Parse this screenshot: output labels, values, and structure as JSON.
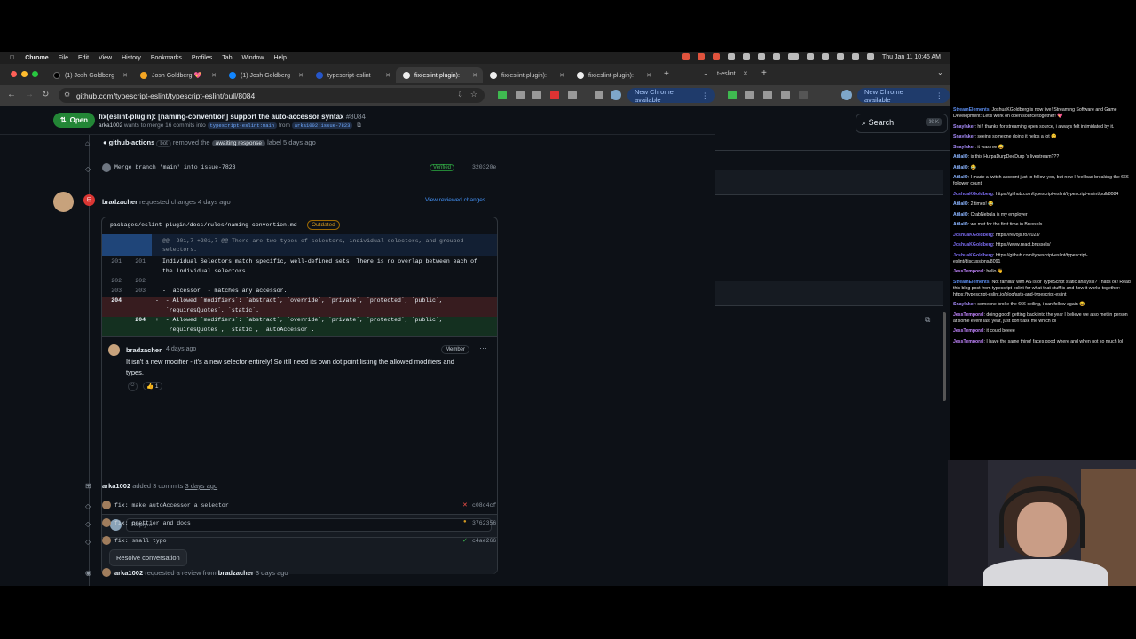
{
  "menubar": {
    "app": "Chrome",
    "items": [
      "File",
      "Edit",
      "View",
      "History",
      "Bookmarks",
      "Profiles",
      "Tab",
      "Window",
      "Help"
    ],
    "clock": "Thu Jan 11  10:45 AM"
  },
  "tabs": [
    {
      "label": "(1) Josh Goldberg"
    },
    {
      "label": "Josh Goldberg 💖"
    },
    {
      "label": "(1) Josh Goldberg"
    },
    {
      "label": "typescript-eslint"
    },
    {
      "label": "fix(eslint-plugin):"
    },
    {
      "label": "fix(eslint-plugin): "
    },
    {
      "label": "fix(eslint-plugin): "
    }
  ],
  "address": {
    "url": "github.com/typescript-eslint/typescript-eslint/pull/8084",
    "new_chrome": "New Chrome available"
  },
  "pr": {
    "state": "Open",
    "title": "fix(eslint-plugin): [naming-convention] support the auto-accessor syntax",
    "number": "#8084",
    "author": "arka1002",
    "sub_mid": "wants to merge 16 commits into",
    "base": "typescript-eslint:main",
    "from": "from",
    "head": "arka1002:issue-7823"
  },
  "timeline": {
    "bot_actor": "github-actions",
    "bot_badge": "bot",
    "bot_removed": "removed the",
    "bot_label": "awaiting response",
    "bot_tail": "label 5 days ago",
    "merge_commit": "Merge branch 'main' into issue-7823",
    "merge_verified": "Verified",
    "merge_sha": "320320e",
    "reviewer": "bradzacher",
    "review_action": "requested changes 4 days ago",
    "view_changes": "View reviewed changes",
    "commits_actor": "arka1002",
    "commits_action": "added 3 commits",
    "commits_time": "3 days ago",
    "commits": [
      {
        "msg": "fix: make autoAccessor a selector",
        "status": "✕",
        "sha": "c08c4cf",
        "color": "#f85149"
      },
      {
        "msg": "fix: prettier and docs",
        "status": "●",
        "sha": "3762356",
        "color": "#d29922"
      },
      {
        "msg": "fix: small typo",
        "status": "✓",
        "sha": "c4ae266",
        "color": "#3fb950"
      }
    ],
    "review_req_actor": "arka1002",
    "review_req_text": "requested a review from",
    "review_req_target": "bradzacher",
    "review_req_time": "3 days ago"
  },
  "diff": {
    "file": "packages/eslint-plugin/docs/rules/naming-convention.md",
    "outdated": "Outdated",
    "hunk": "@@ -201,7 +201,7 @@ There are two types of selectors, individual selectors, and grouped",
    "hunk2": "selectors.",
    "rows": [
      {
        "o": "201",
        "n": "201",
        "t": "Individual Selectors match specific, well-defined sets. There is no overlap between each of"
      },
      {
        "o": "",
        "n": "",
        "t": "the individual selectors."
      },
      {
        "o": "202",
        "n": "202",
        "t": ""
      },
      {
        "o": "203",
        "n": "203",
        "t": "- `accessor` - matches any accessor."
      },
      {
        "o": "204",
        "n": "",
        "t": "-  - Allowed `modifiers`: `abstract`, `override`, `private`, `protected`, `public`,"
      },
      {
        "o": "",
        "n": "",
        "t": "   `requiresQuotes`, `static`."
      },
      {
        "o": "",
        "n": "204",
        "t": "+  - Allowed `modifiers`: `abstract`, `override`, `private`, `protected`, `public`,"
      },
      {
        "o": "",
        "n": "",
        "t": "   `requiresQuotes`, `static`, `autoAccessor`."
      }
    ]
  },
  "comment": {
    "author": "bradzacher",
    "time": "4 days ago",
    "role": "Member",
    "text1": "It isn't a new modifier - it's a new selector entirely! So it'll need its own dot point listing the allowed modifiers and",
    "text2": "types.",
    "reaction": "👍 1",
    "reply_placeholder": "Reply...",
    "resolve": "Resolve conversation"
  },
  "right_chrome": {
    "new_chrome": "New Chrome available",
    "tab": "t-eslint",
    "search": "Search"
  },
  "chat": [
    {
      "user": "StreamElements",
      "color": "#5b8def",
      "text": "JoshuaKGoldberg is now live! Streaming Software and Game Development: Let's work on open source together! 💖"
    },
    {
      "user": "Snaylaker",
      "color": "#a78bfa",
      "text": "hi ! thanks for streaming open source, i always felt intimidated by it."
    },
    {
      "user": "Snaylaker",
      "color": "#a78bfa",
      "text": "seeing someone doing it helps a lot 😊"
    },
    {
      "user": "Snaylaker",
      "color": "#a78bfa",
      "text": "it was me 😅"
    },
    {
      "user": "AtilaIO",
      "color": "#8ab4ff",
      "text": "is this HurpaDurpDeeDurp 's livestream???"
    },
    {
      "user": "AtilaIO",
      "color": "#8ab4ff",
      "text": "😂"
    },
    {
      "user": "AtilaIO",
      "color": "#8ab4ff",
      "text": "I made a twitch account just to follow you, but now I feel bad breaking the 666 follower count"
    },
    {
      "user": "JoshuaKGoldberg",
      "color": "#7c6cf0",
      "text": "https://github.com/typescript-eslint/typescript-eslint/pull/8084"
    },
    {
      "user": "AtilaIO",
      "color": "#8ab4ff",
      "text": "2 times! 😂"
    },
    {
      "user": "AtilaIO",
      "color": "#8ab4ff",
      "text": "CrabNebula is my employer"
    },
    {
      "user": "AtilaIO",
      "color": "#8ab4ff",
      "text": "we met for the first time in Brussels"
    },
    {
      "user": "JoshuaKGoldberg",
      "color": "#7c6cf0",
      "text": "https://revojs.ro/2023/"
    },
    {
      "user": "JoshuaKGoldberg",
      "color": "#7c6cf0",
      "text": "https://www.react.brussels/"
    },
    {
      "user": "JoshuaKGoldberg",
      "color": "#7c6cf0",
      "text": "https://github.com/typescript-eslint/typescript-eslint/discussions/8091"
    },
    {
      "user": "JessTemporal",
      "color": "#c084fc",
      "text": "hello 👋"
    },
    {
      "user": "StreamElements",
      "color": "#5b8def",
      "text": "Not familiar with ASTs or TypeScript static analysis? That's ok! Read this blog post from typescript-eslint for what that stuff is and how it works together: https://typescript-eslint.io/blog/asts-and-typescript-eslint"
    },
    {
      "user": "Snaylaker",
      "color": "#a78bfa",
      "text": "someone broke the 666 ceiling, i can follow again 😂"
    },
    {
      "user": "JessTemporal",
      "color": "#c084fc",
      "text": "doing good! getting back into the year I believe we also met in person at some event last year, just don't ask me which lol"
    },
    {
      "user": "JessTemporal",
      "color": "#c084fc",
      "text": "it could beeee"
    },
    {
      "user": "JessTemporal",
      "color": "#c084fc",
      "text": "I have the same thing! faces good where and when not so much lol"
    }
  ]
}
